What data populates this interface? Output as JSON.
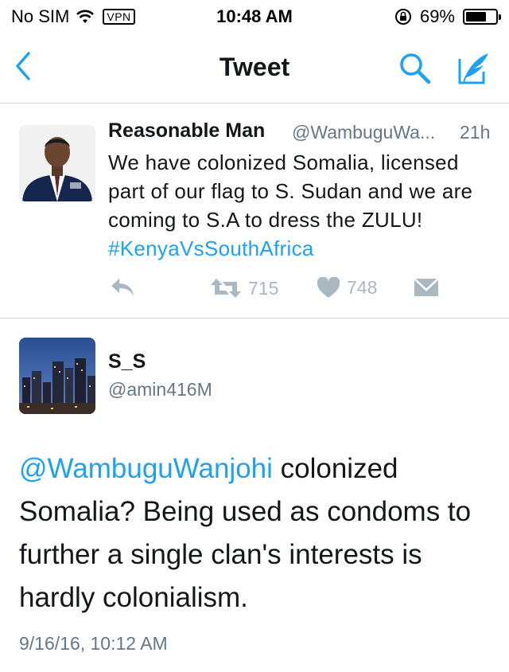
{
  "status_bar": {
    "carrier": "No SIM",
    "vpn": "VPN",
    "time": "10:48 AM",
    "battery": "69%",
    "battery_level": 0.69
  },
  "nav": {
    "title": "Tweet",
    "back_icon": "chevron-left-icon",
    "search_icon": "search-icon",
    "compose_icon": "compose-icon"
  },
  "quoted_tweet": {
    "name": "Reasonable Man",
    "handle": "@WambuguWa...",
    "time": "21h",
    "text": "We have colonized Somalia, licensed part of our flag to S. Sudan and we are coming to S.A to dress the ZULU! ",
    "hashtag": "#KenyaVsSouthAfrica",
    "retweets": "715",
    "likes": "748"
  },
  "reply": {
    "name": "S_S",
    "handle": "@amin416M",
    "mention": "@WambuguWanjohi",
    "text": " colonized Somalia? Being used as condoms to further a single clan's interests is hardly colonialism.",
    "date": "9/16/16, 10:12 AM"
  },
  "colors": {
    "accent": "#1da1f2",
    "secondary_text": "#657786",
    "action_gray": "#aab8c2"
  }
}
